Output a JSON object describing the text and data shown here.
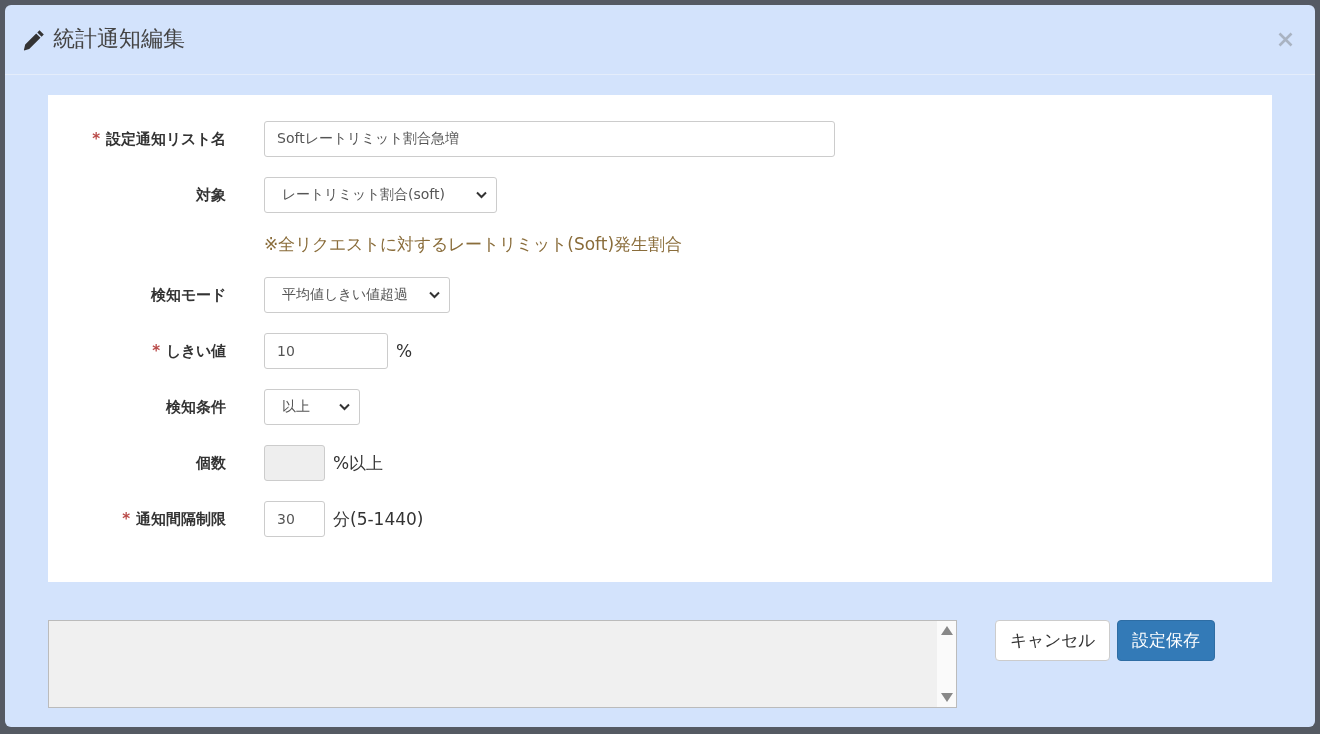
{
  "dialog": {
    "title": "統計通知編集"
  },
  "form": {
    "fields": [
      {
        "kind": "text",
        "required_mark": "*",
        "label": "設定通知リスト名",
        "value": "Softレートリミット割合急増"
      },
      {
        "kind": "select",
        "label": "対象",
        "value": "レートリミット割合(soft)",
        "note": "※全リクエストに対するレートリミット(Soft)発生割合"
      },
      {
        "kind": "select",
        "label": "検知モード",
        "value": "平均値しきい値超過"
      },
      {
        "kind": "text",
        "required_mark": "*",
        "label": "しきい値",
        "value": "10",
        "suffix": "%"
      },
      {
        "kind": "select",
        "label": "検知条件",
        "value": "以上"
      },
      {
        "kind": "text",
        "label": "個数",
        "disabled": true,
        "suffix": "%以上"
      },
      {
        "kind": "text",
        "required_mark": "*",
        "label": "通知間隔制限",
        "value": "30",
        "suffix": "分(5-1440)"
      }
    ]
  },
  "message_area": {
    "disabled": true
  },
  "buttons": [
    {
      "label": "キャンセル",
      "kind": "default"
    },
    {
      "label": "設定保存",
      "kind": "primary"
    }
  ]
}
